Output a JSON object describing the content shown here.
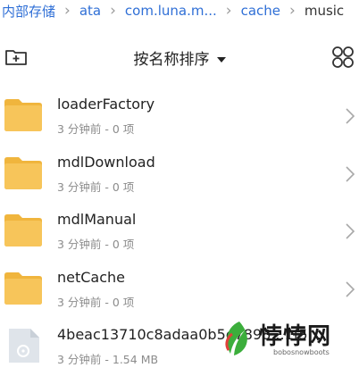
{
  "breadcrumb": [
    {
      "label": "内部存储"
    },
    {
      "label": "ata"
    },
    {
      "label": "com.luna.m..."
    },
    {
      "label": "cache"
    },
    {
      "label": "music"
    }
  ],
  "toolbar": {
    "new_folder_icon": "folder-plus-icon",
    "sort_label": "按名称排序",
    "view_toggle_icon": "grid-view-icon"
  },
  "files": [
    {
      "name": "loaderFactory",
      "meta": "3 分钟前 - 0 项",
      "type": "folder"
    },
    {
      "name": "mdlDownload",
      "meta": "3 分钟前 - 0 项",
      "type": "folder"
    },
    {
      "name": "mdlManual",
      "meta": "3 分钟前 - 0 项",
      "type": "folder"
    },
    {
      "name": "netCache",
      "meta": "3 分钟前 - 0 项",
      "type": "folder"
    },
    {
      "name": "4beac13710c8adaa0b5e7898...1f5...",
      "meta": "3 分钟前 - 1.54 MB",
      "type": "file"
    }
  ],
  "watermark": {
    "main": "悖悖网",
    "sub": "bobosnowboots"
  },
  "colors": {
    "link": "#2f6fd6",
    "folder": "#f7c55a",
    "folder_tab": "#f0b53d",
    "file_icon": "#dfe4ea"
  }
}
